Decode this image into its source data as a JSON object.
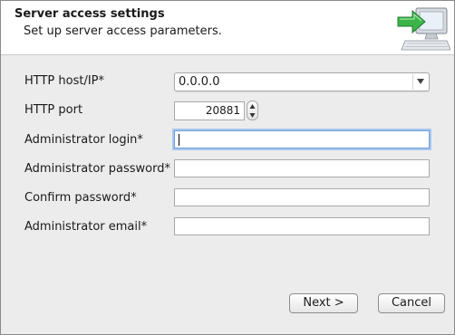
{
  "header": {
    "title": "Server access settings",
    "subtitle": "Set up server access parameters."
  },
  "icons": {
    "header": "computer-with-green-arrow-icon",
    "dropdown": "chevron-down-icon",
    "spinner_up": "triangle-up-icon",
    "spinner_down": "triangle-down-icon"
  },
  "form": {
    "http_host": {
      "label": "HTTP host/IP*",
      "value": "0.0.0.0"
    },
    "http_port": {
      "label": "HTTP port",
      "value": "20881"
    },
    "admin_login": {
      "label": "Administrator login*",
      "value": ""
    },
    "admin_password": {
      "label": "Administrator password*",
      "value": ""
    },
    "confirm_password": {
      "label": "Confirm password*",
      "value": ""
    },
    "admin_email": {
      "label": "Administrator email*",
      "value": ""
    }
  },
  "buttons": {
    "next": "Next >",
    "cancel": "Cancel"
  },
  "colors": {
    "focus_ring": "#a8c7ee",
    "arrow_green": "#3bb54a",
    "window_bg": "#ececec"
  }
}
